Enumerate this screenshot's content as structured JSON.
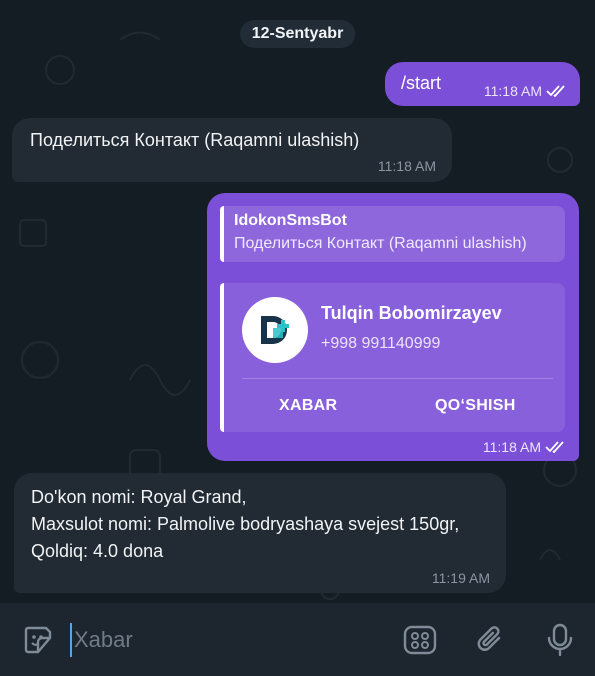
{
  "date_pill": "12-Sentyabr",
  "messages": {
    "start": {
      "text": "/start",
      "time": "11:18 AM"
    },
    "share_contact": {
      "text": "Поделиться Контакт (Raqamni ulashish)",
      "time": "11:18 AM"
    },
    "contact_card": {
      "reply_name": "IdokonSmsBot",
      "reply_text": "Поделиться Контакт (Raqamni ulashish)",
      "contact_name": "Tulqin Bobomirzayev",
      "contact_phone": "+998 991140999",
      "btn_message": "XABAR",
      "btn_add": "QO‘SHISH",
      "time": "11:18 AM"
    },
    "info": {
      "line1": "Do'kon nomi: Royal Grand,",
      "line2": "Maxsulot nomi: Palmolive bodryashaya svejest 150gr,",
      "line3": "Qoldiq: 4.0 dona",
      "time": "11:19 AM"
    }
  },
  "input": {
    "placeholder": "Xabar"
  },
  "icons": {
    "sticker": "sticker-icon",
    "apps": "apps-grid-icon",
    "attach": "paperclip-icon",
    "mic": "microphone-icon",
    "read": "double-check-icon"
  },
  "colors": {
    "outgoing": "#7c4fd8",
    "incoming": "#222a33",
    "background": "#141c24",
    "input_bar": "#1d252e"
  }
}
